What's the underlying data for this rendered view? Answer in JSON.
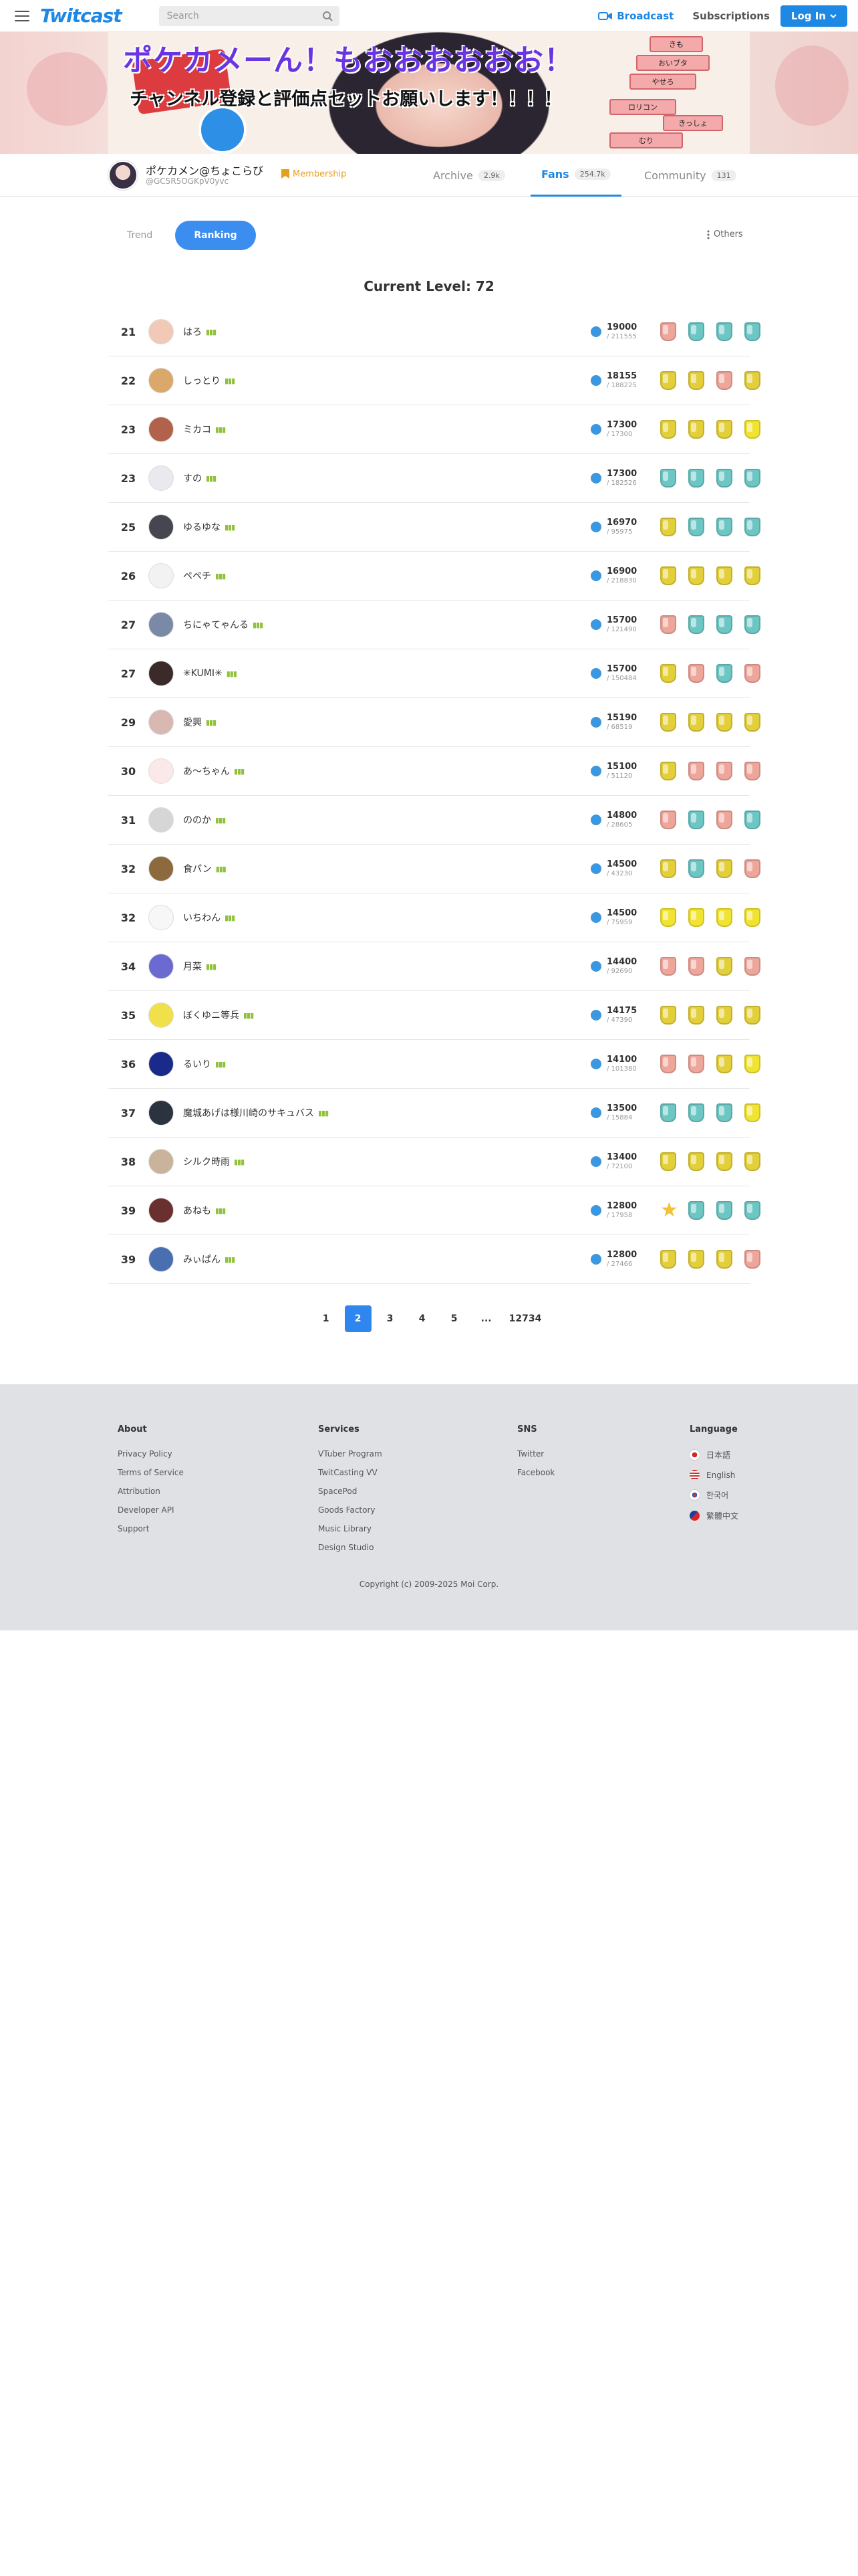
{
  "header": {
    "logo": "Twitcast",
    "search_placeholder": "Search",
    "broadcast": "Broadcast",
    "subscriptions": "Subscriptions",
    "login": "Log In"
  },
  "banner": {
    "title_line1": "ポケカメーん！もおおおおおお！",
    "title_line2": "チャンネル登録と評価点セットお願いします！！！！",
    "boards": [
      "きも",
      "おいブタ",
      "やせろ",
      "ロリコン",
      "きっしょ",
      "むり"
    ]
  },
  "channel": {
    "name": "ポケカメン@ちょこらび",
    "id": "@GC5R5OGKpV0yvc",
    "membership": "Membership",
    "tabs": [
      {
        "label": "Archive",
        "count": "2.9k"
      },
      {
        "label": "Fans",
        "count": "254.7k"
      },
      {
        "label": "Community",
        "count": "131"
      }
    ]
  },
  "toggles": {
    "trend": "Trend",
    "ranking": "Ranking",
    "others": "Others"
  },
  "level_text": "Current Level: 72",
  "ranking": [
    {
      "rank": "21",
      "name": "はろ",
      "points": "19000",
      "sub": "/ 211555",
      "medals": [
        "pink",
        "teal",
        "teal",
        "teal"
      ],
      "av": "#f1c9b6"
    },
    {
      "rank": "22",
      "name": "しっとり",
      "points": "18155",
      "sub": "/ 188225",
      "medals": [
        "gold",
        "gold",
        "pink",
        "gold"
      ],
      "av": "#d9a86a"
    },
    {
      "rank": "23",
      "name": "ミカコ",
      "points": "17300",
      "sub": "/ 17300",
      "medals": [
        "gold",
        "gold",
        "gold",
        "yellow"
      ],
      "av": "#b0634a"
    },
    {
      "rank": "23",
      "name": "すの",
      "points": "17300",
      "sub": "/ 182526",
      "medals": [
        "teal",
        "teal",
        "teal",
        "teal"
      ],
      "av": "#e9e9ee"
    },
    {
      "rank": "25",
      "name": "ゆるゆな",
      "points": "16970",
      "sub": "/ 95975",
      "medals": [
        "gold",
        "teal",
        "teal",
        "teal"
      ],
      "av": "#45464f"
    },
    {
      "rank": "26",
      "name": "ペペチ",
      "points": "16900",
      "sub": "/ 218830",
      "medals": [
        "gold",
        "gold",
        "gold",
        "gold"
      ],
      "av": "#f2f2f2"
    },
    {
      "rank": "27",
      "name": "ちにゃてゃんる",
      "points": "15700",
      "sub": "/ 121490",
      "medals": [
        "pink",
        "teal",
        "teal",
        "teal"
      ],
      "av": "#7a8aa6"
    },
    {
      "rank": "27",
      "name": "✳KUMI✳",
      "points": "15700",
      "sub": "/ 150484",
      "medals": [
        "gold",
        "pink",
        "teal",
        "pink"
      ],
      "av": "#3a2a2a"
    },
    {
      "rank": "29",
      "name": "愛興",
      "points": "15190",
      "sub": "/ 68519",
      "medals": [
        "gold",
        "gold",
        "gold",
        "gold"
      ],
      "av": "#d8b8b0"
    },
    {
      "rank": "30",
      "name": "あ〜ちゃん",
      "points": "15100",
      "sub": "/ 51120",
      "medals": [
        "gold",
        "pink",
        "pink",
        "pink"
      ],
      "av": "#fbe8e8"
    },
    {
      "rank": "31",
      "name": "ののか",
      "points": "14800",
      "sub": "/ 28605",
      "medals": [
        "pink",
        "teal",
        "pink",
        "teal"
      ],
      "av": "#d6d6d6"
    },
    {
      "rank": "32",
      "name": "食パン",
      "points": "14500",
      "sub": "/ 43230",
      "medals": [
        "gold",
        "teal",
        "gold",
        "pink"
      ],
      "av": "#8c6a3e"
    },
    {
      "rank": "32",
      "name": "いちわん",
      "points": "14500",
      "sub": "/ 75959",
      "medals": [
        "yellow",
        "yellow",
        "yellow",
        "yellow"
      ],
      "av": "#f7f7f7"
    },
    {
      "rank": "34",
      "name": "月菜",
      "points": "14400",
      "sub": "/ 92690",
      "medals": [
        "pink",
        "pink",
        "gold",
        "pink"
      ],
      "av": "#6a6ad0"
    },
    {
      "rank": "35",
      "name": "ぼくゆニ等兵",
      "points": "14175",
      "sub": "/ 47390",
      "medals": [
        "gold",
        "gold",
        "gold",
        "gold"
      ],
      "av": "#f0e04a"
    },
    {
      "rank": "36",
      "name": "るいり",
      "points": "14100",
      "sub": "/ 101380",
      "medals": [
        "pink",
        "pink",
        "gold",
        "yellow"
      ],
      "av": "#1a2a8a"
    },
    {
      "rank": "37",
      "name": "魔城あげは様川崎のサキュバス",
      "points": "13500",
      "sub": "/ 15884",
      "medals": [
        "teal",
        "teal",
        "teal",
        "yellow"
      ],
      "av": "#2b3340"
    },
    {
      "rank": "38",
      "name": "シルク時雨",
      "points": "13400",
      "sub": "/ 72100",
      "medals": [
        "gold",
        "gold",
        "gold",
        "gold"
      ],
      "av": "#c9b39a"
    },
    {
      "rank": "39",
      "name": "あねも",
      "points": "12800",
      "sub": "/ 17958",
      "medals": [
        "star",
        "teal",
        "teal",
        "teal"
      ],
      "av": "#6a3030"
    },
    {
      "rank": "39",
      "name": "みぃぱん",
      "points": "12800",
      "sub": "/ 27466",
      "medals": [
        "gold",
        "gold",
        "gold",
        "pink"
      ],
      "av": "#4a6fb0"
    }
  ],
  "pagination": [
    "1",
    "2",
    "3",
    "4",
    "5",
    "...",
    "12734"
  ],
  "pagination_active": "2",
  "footer": {
    "about": {
      "title": "About",
      "links": [
        "Privacy Policy",
        "Terms of Service",
        "Attribution",
        "Developer API",
        "Support"
      ]
    },
    "services": {
      "title": "Services",
      "links": [
        "VTuber Program",
        "TwitCasting VV",
        "SpacePod",
        "Goods Factory",
        "Music Library",
        "Design Studio"
      ]
    },
    "sns": {
      "title": "SNS",
      "links": [
        "Twitter",
        "Facebook"
      ]
    },
    "language": {
      "title": "Language",
      "links": [
        "日本語",
        "English",
        "한국어",
        "繁體中文"
      ]
    },
    "copyright": "Copyright (c) 2009-2025 Moi Corp."
  }
}
